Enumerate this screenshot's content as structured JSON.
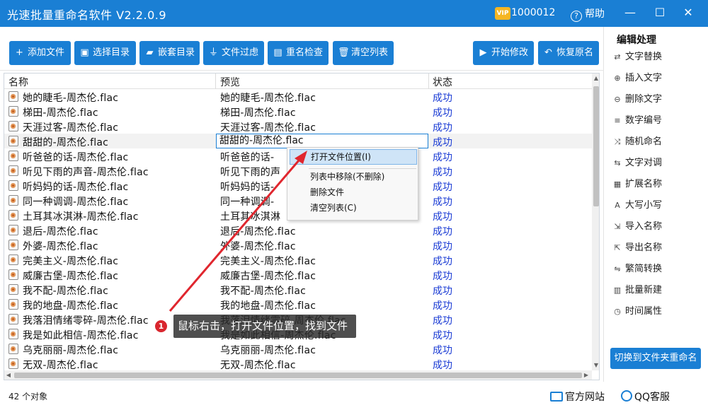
{
  "window": {
    "title": "光速批量重命名软件 V2.2.0.9",
    "vip_badge": "VIP",
    "vip_number": "1000012",
    "help_label": "帮助",
    "help_icon": "?",
    "minimize_glyph": "—",
    "maximize_glyph": "☐",
    "close_glyph": "✕"
  },
  "toolbar": {
    "buttons": [
      {
        "label": "添加文件",
        "icon": "plus-icon",
        "glyph": "+"
      },
      {
        "label": "选择目录",
        "icon": "folder-add-icon",
        "glyph": "▣"
      },
      {
        "label": "嵌套目录",
        "icon": "folder-nested-icon",
        "glyph": "▰"
      },
      {
        "label": "文件过虑",
        "icon": "filter-icon",
        "glyph": "⏚"
      },
      {
        "label": "重名检查",
        "icon": "duplicate-check-icon",
        "glyph": "▤"
      },
      {
        "label": "清空列表",
        "icon": "trash-icon",
        "glyph": "🗑"
      },
      {
        "label": "开始修改",
        "icon": "play-icon",
        "glyph": "▶"
      },
      {
        "label": "恢复原名",
        "icon": "undo-icon",
        "glyph": "↶"
      }
    ]
  },
  "list": {
    "columns": {
      "name": "名称",
      "preview": "预览",
      "status": "状态"
    },
    "rows": [
      {
        "name": "她的睫毛-周杰伦.flac",
        "preview": "她的睫毛-周杰伦.flac",
        "status": "成功"
      },
      {
        "name": "梯田-周杰伦.flac",
        "preview": "梯田-周杰伦.flac",
        "status": "成功"
      },
      {
        "name": "天涯过客-周杰伦.flac",
        "preview": "天涯过客-周杰伦.flac",
        "status": "成功"
      },
      {
        "name": "甜甜的-周杰伦.flac",
        "preview": "甜甜的-周杰伦.flac",
        "status": "成功",
        "selected": true,
        "editing": true
      },
      {
        "name": "听爸爸的话-周杰伦.flac",
        "preview": "听爸爸的话-",
        "status": "成功"
      },
      {
        "name": "听见下雨的声音-周杰伦.flac",
        "preview": "听见下雨的声",
        "status": "成功"
      },
      {
        "name": "听妈妈的话-周杰伦.flac",
        "preview": "听妈妈的话-",
        "status": "成功"
      },
      {
        "name": "同一种调调-周杰伦.flac",
        "preview": "同一种调调-",
        "status": "成功"
      },
      {
        "name": "土耳其冰淇淋-周杰伦.flac",
        "preview": "土耳其冰淇淋",
        "status": "成功"
      },
      {
        "name": "退后-周杰伦.flac",
        "preview": "退后-周杰伦.flac",
        "status": "成功"
      },
      {
        "name": "外婆-周杰伦.flac",
        "preview": "外婆-周杰伦.flac",
        "status": "成功"
      },
      {
        "name": "完美主义-周杰伦.flac",
        "preview": "完美主义-周杰伦.flac",
        "status": "成功"
      },
      {
        "name": "威廉古堡-周杰伦.flac",
        "preview": "威廉古堡-周杰伦.flac",
        "status": "成功"
      },
      {
        "name": "我不配-周杰伦.flac",
        "preview": "我不配-周杰伦.flac",
        "status": "成功"
      },
      {
        "name": "我的地盘-周杰伦.flac",
        "preview": "我的地盘-周杰伦.flac",
        "status": "成功"
      },
      {
        "name": "我落泪情绪零碎-周杰伦.flac",
        "preview": "我落泪情绪零碎-周杰伦.flac",
        "status": "成功"
      },
      {
        "name": "我是如此相信-周杰伦.flac",
        "preview": "我是如此相信-周杰伦.flac",
        "status": "成功"
      },
      {
        "name": "乌克丽丽-周杰伦.flac",
        "preview": "乌克丽丽-周杰伦.flac",
        "status": "成功"
      },
      {
        "name": "无双-周杰伦.flac",
        "preview": "无双-周杰伦.flac",
        "status": "成功"
      }
    ]
  },
  "context_menu": {
    "items": [
      {
        "label": "打开文件位置(I)",
        "highlighted": true
      },
      {
        "label": "列表中移除(不删除)"
      },
      {
        "label": "删除文件"
      },
      {
        "label": "清空列表(C)"
      }
    ]
  },
  "annotation": {
    "badge": "1",
    "text": "鼠标右击，打开文件位置，找到文件",
    "color": "#d9262e"
  },
  "sidebar": {
    "title": "编辑处理",
    "items": [
      {
        "label": "文字替换",
        "icon": "replace-icon",
        "glyph": "⇄"
      },
      {
        "label": "插入文字",
        "icon": "insert-text-icon",
        "glyph": "⊕"
      },
      {
        "label": "删除文字",
        "icon": "delete-text-icon",
        "glyph": "⊖"
      },
      {
        "label": "数字编号",
        "icon": "numbering-icon",
        "glyph": "≡"
      },
      {
        "label": "随机命名",
        "icon": "shuffle-icon",
        "glyph": "⤨"
      },
      {
        "label": "文字对调",
        "icon": "swap-icon",
        "glyph": "⇆"
      },
      {
        "label": "扩展名称",
        "icon": "extension-icon",
        "glyph": "▦"
      },
      {
        "label": "大写小写",
        "icon": "case-icon",
        "glyph": "A"
      },
      {
        "label": "导入名称",
        "icon": "import-icon",
        "glyph": "⇲"
      },
      {
        "label": "导出名称",
        "icon": "export-icon",
        "glyph": "⇱"
      },
      {
        "label": "繁简转换",
        "icon": "convert-icon",
        "glyph": "⇋"
      },
      {
        "label": "批量新建",
        "icon": "batch-new-icon",
        "glyph": "▥"
      },
      {
        "label": "时间属性",
        "icon": "clock-icon",
        "glyph": "◷"
      }
    ],
    "switch_button": "切换到文件夹重命名"
  },
  "statusbar": {
    "object_count": "42 个对象",
    "website": "官方网站",
    "qq": "QQ客服"
  },
  "colors": {
    "accent": "#1a7fd4",
    "status_ok": "#1a3bd4"
  }
}
